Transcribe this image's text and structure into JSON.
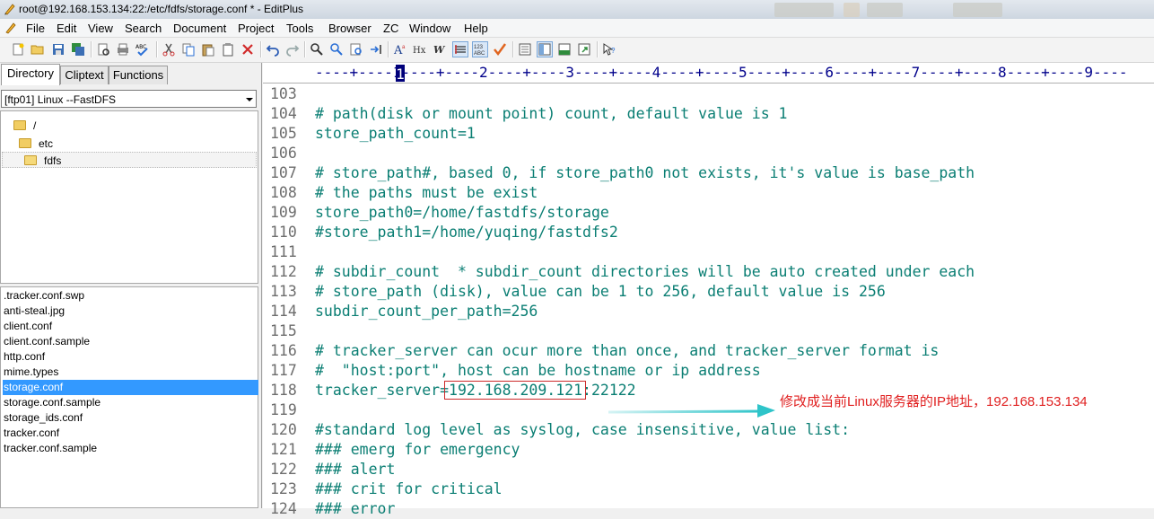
{
  "window": {
    "title": "root@192.168.153.134:22:/etc/fdfs/storage.conf * - EditPlus"
  },
  "menu": [
    "File",
    "Edit",
    "View",
    "Search",
    "Document",
    "Project",
    "Tools",
    "Browser",
    "ZC",
    "Window",
    "Help"
  ],
  "left_panel": {
    "tabs": [
      "Directory",
      "Cliptext",
      "Functions"
    ],
    "active_tab": "Directory",
    "drive": "[ftp01] Linux --FastDFS",
    "folders": [
      "/",
      "etc",
      "fdfs"
    ],
    "selected_folder": "fdfs",
    "files": [
      ".tracker.conf.swp",
      "anti-steal.jpg",
      "client.conf",
      "client.conf.sample",
      "http.conf",
      "mime.types",
      "storage.conf",
      "storage.conf.sample",
      "storage_ids.conf",
      "tracker.conf",
      "tracker.conf.sample"
    ],
    "selected_file": "storage.conf"
  },
  "editor": {
    "ruler": "----+----1----+----2----+----3----+----4----+----5----+----6----+----7----+----8----+----9----",
    "ruler_cursor": "1",
    "lines": [
      {
        "num": "103",
        "text": ""
      },
      {
        "num": "104",
        "text": "# path(disk or mount point) count, default value is 1"
      },
      {
        "num": "105",
        "text": "store_path_count=1"
      },
      {
        "num": "106",
        "text": ""
      },
      {
        "num": "107",
        "text": "# store_path#, based 0, if store_path0 not exists, it's value is base_path"
      },
      {
        "num": "108",
        "text": "# the paths must be exist"
      },
      {
        "num": "109",
        "text": "store_path0=/home/fastdfs/storage"
      },
      {
        "num": "110",
        "text": "#store_path1=/home/yuqing/fastdfs2"
      },
      {
        "num": "111",
        "text": ""
      },
      {
        "num": "112",
        "text": "# subdir_count  * subdir_count directories will be auto created under each"
      },
      {
        "num": "113",
        "text": "# store_path (disk), value can be 1 to 256, default value is 256"
      },
      {
        "num": "114",
        "text": "subdir_count_per_path=256"
      },
      {
        "num": "115",
        "text": ""
      },
      {
        "num": "116",
        "text": "# tracker_server can ocur more than once, and tracker_server format is"
      },
      {
        "num": "117",
        "text": "#  \"host:port\", host can be hostname or ip address"
      },
      {
        "num": "118",
        "text": "tracker_server=192.168.209.121:22122"
      },
      {
        "num": "119",
        "text": ""
      },
      {
        "num": "120",
        "text": "#standard log level as syslog, case insensitive, value list:"
      },
      {
        "num": "121",
        "text": "### emerg for emergency"
      },
      {
        "num": "122",
        "text": "### alert"
      },
      {
        "num": "123",
        "text": "### crit for critical"
      },
      {
        "num": "124",
        "text": "### error"
      }
    ],
    "annotation": "修改成当前Linux服务器的IP地址，192.168.153.134"
  },
  "colors": {
    "code": "#0a7e73",
    "line_numbers": "#6d6d6d",
    "annotation": "#e02020",
    "selection": "#3399ff",
    "arrow": "#2ec4c9"
  }
}
